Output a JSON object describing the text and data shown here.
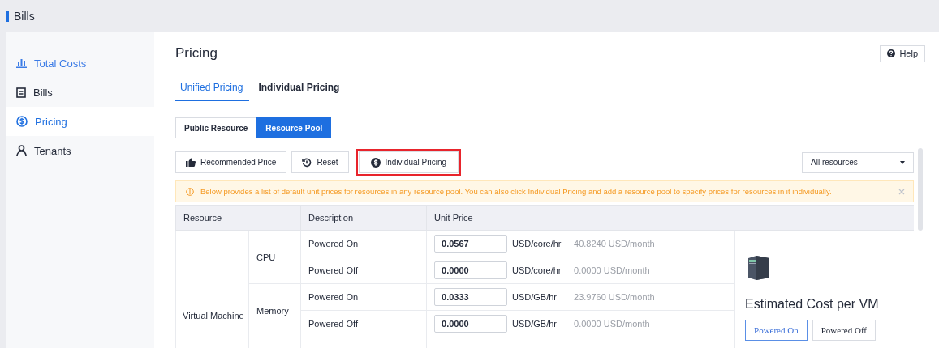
{
  "header": {
    "title": "Bills"
  },
  "sidebar": {
    "items": [
      {
        "label": "Total Costs",
        "selected": false
      },
      {
        "label": "Bills",
        "selected": false
      },
      {
        "label": "Pricing",
        "selected": true
      },
      {
        "label": "Tenants",
        "selected": false
      }
    ]
  },
  "page": {
    "title": "Pricing",
    "help_button": "Help"
  },
  "tabs": [
    {
      "label": "Unified Pricing",
      "selected": true
    },
    {
      "label": "Individual Pricing",
      "selected": false
    }
  ],
  "scope_toggle": [
    {
      "label": "Public Resource",
      "selected": false
    },
    {
      "label": "Resource Pool",
      "selected": true
    }
  ],
  "toolbar": {
    "buttons": [
      {
        "label": "Recommended Price",
        "highlighted": false
      },
      {
        "label": "Reset",
        "highlighted": false
      },
      {
        "label": "Individual Pricing",
        "highlighted": true
      }
    ],
    "filter": {
      "value": "All resources"
    }
  },
  "notice": {
    "text": "Below provides a list of default unit prices for resources in any resource pool. You can also click Individual Pricing and add a resource pool to specify prices for resources in it individually."
  },
  "table": {
    "columns": [
      "Resource",
      "Description",
      "Unit Price"
    ],
    "groups": [
      {
        "resource": "Virtual Machine",
        "subgroups": [
          {
            "name": "CPU",
            "rows": [
              {
                "description": "Powered On",
                "price": "0.0567",
                "unit": "USD/core/hr",
                "monthly": "40.8240 USD/month"
              },
              {
                "description": "Powered Off",
                "price": "0.0000",
                "unit": "USD/core/hr",
                "monthly": "0.0000 USD/month"
              }
            ]
          },
          {
            "name": "Memory",
            "rows": [
              {
                "description": "Powered On",
                "price": "0.0333",
                "unit": "USD/GB/hr",
                "monthly": "23.9760 USD/month"
              },
              {
                "description": "Powered Off",
                "price": "0.0000",
                "unit": "USD/GB/hr",
                "monthly": "0.0000 USD/month"
              }
            ]
          }
        ]
      }
    ]
  },
  "estimate": {
    "title": "Estimated Cost per VM",
    "options": [
      {
        "label": "Powered On",
        "selected": true
      },
      {
        "label": "Powered Off",
        "selected": false
      }
    ]
  }
}
